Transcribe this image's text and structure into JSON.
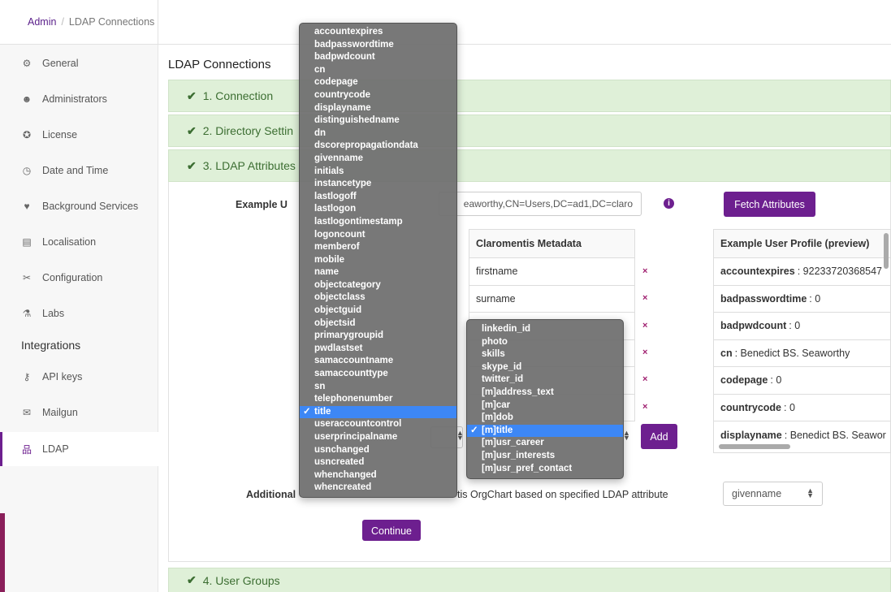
{
  "breadcrumb": {
    "root": "Admin",
    "separator": "/",
    "current": "LDAP Connections"
  },
  "sidebar": {
    "items": [
      {
        "label": "General",
        "icon": "gears-icon",
        "glyph": "⚙"
      },
      {
        "label": "Administrators",
        "icon": "users-icon",
        "glyph": "☻"
      },
      {
        "label": "License",
        "icon": "license-icon",
        "glyph": "✪"
      },
      {
        "label": "Date and Time",
        "icon": "clock-icon",
        "glyph": "◷"
      },
      {
        "label": "Background Services",
        "icon": "heartbeat-icon",
        "glyph": "♥"
      },
      {
        "label": "Localisation",
        "icon": "translate-icon",
        "glyph": "▤"
      },
      {
        "label": "Configuration",
        "icon": "tools-icon",
        "glyph": "✂"
      },
      {
        "label": "Labs",
        "icon": "flask-icon",
        "glyph": "⚗"
      }
    ],
    "integrations_heading": "Integrations",
    "integration_items": [
      {
        "label": "API keys",
        "icon": "key-icon",
        "glyph": "⚷"
      },
      {
        "label": "Mailgun",
        "icon": "envelope-icon",
        "glyph": "✉"
      },
      {
        "label": "LDAP",
        "icon": "sitemap-icon",
        "glyph": "品",
        "active": true
      }
    ]
  },
  "main": {
    "title": "LDAP Connections",
    "panels": [
      {
        "label": "1. Connection"
      },
      {
        "label": "2. Directory Settin"
      },
      {
        "label": "3. LDAP Attributes"
      },
      {
        "label": "4. User Groups"
      }
    ],
    "example_label": "Example U",
    "example_dn_value": "eaworthy,CN=Users,DC=ad1,DC=claro",
    "fetch_button": "Fetch Attributes",
    "mapping": {
      "header": "Claromentis Metadata",
      "rows": [
        "firstname",
        "surname",
        "",
        "",
        "",
        ""
      ],
      "remove_glyph": "×"
    },
    "add_button": "Add",
    "preview": {
      "header": "Example User Profile (preview)",
      "rows": [
        {
          "key": "accountexpires",
          "value": "92233720368547"
        },
        {
          "key": "badpasswordtime",
          "value": "0"
        },
        {
          "key": "badpwdcount",
          "value": "0"
        },
        {
          "key": "cn",
          "value": "Benedict BS. Seaworthy"
        },
        {
          "key": "codepage",
          "value": "0"
        },
        {
          "key": "countrycode",
          "value": "0"
        },
        {
          "key": "displayname",
          "value": "Benedict BS. Seawor"
        }
      ]
    },
    "additional_label": "Additional",
    "orgchart_text": "tis OrgChart based on specified LDAP attribute",
    "orgchart_select_value": "givenname",
    "continue_button": "Continue"
  },
  "ldap_attribute_dropdown": {
    "selected": "title",
    "options": [
      "accountexpires",
      "badpasswordtime",
      "badpwdcount",
      "cn",
      "codepage",
      "countrycode",
      "displayname",
      "distinguishedname",
      "dn",
      "dscorepropagationdata",
      "givenname",
      "initials",
      "instancetype",
      "lastlogoff",
      "lastlogon",
      "lastlogontimestamp",
      "logoncount",
      "memberof",
      "mobile",
      "name",
      "objectcategory",
      "objectclass",
      "objectguid",
      "objectsid",
      "primarygroupid",
      "pwdlastset",
      "samaccountname",
      "samaccounttype",
      "sn",
      "telephonenumber",
      "title",
      "useraccountcontrol",
      "userprincipalname",
      "usnchanged",
      "usncreated",
      "whenchanged",
      "whencreated"
    ]
  },
  "metadata_dropdown": {
    "selected": "[m]title",
    "options": [
      "linkedin_id",
      "photo",
      "skills",
      "skype_id",
      "twitter_id",
      "[m]address_text",
      "[m]car",
      "[m]dob",
      "[m]title",
      "[m]usr_career",
      "[m]usr_interests",
      "[m]usr_pref_contact"
    ]
  },
  "colors": {
    "accent": "#6d1f8f",
    "panel_green": "#dff0d8",
    "panel_text": "#3c6e32",
    "selection": "#3d87f5"
  }
}
